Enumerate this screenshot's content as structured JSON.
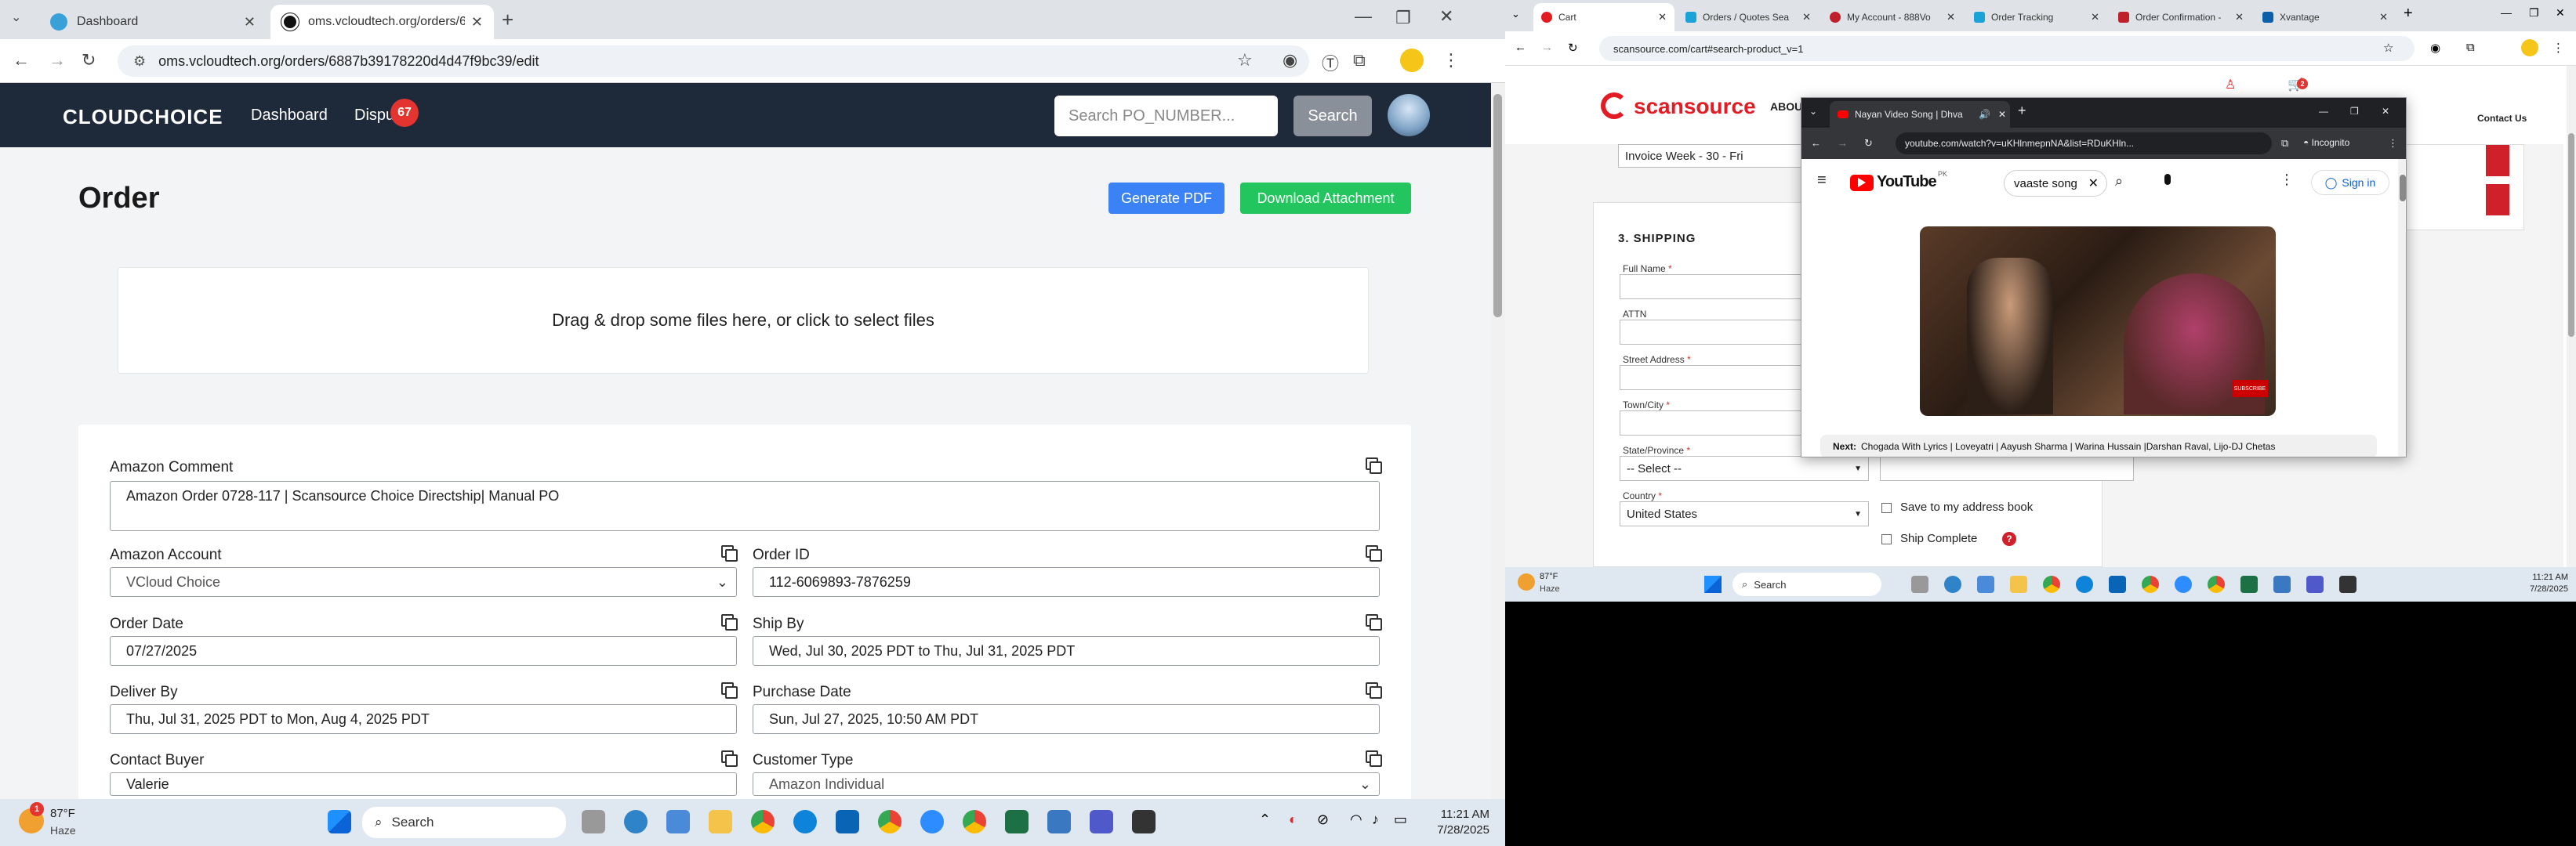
{
  "left_browser": {
    "tabs": [
      {
        "label": "Dashboard"
      },
      {
        "label": "oms.vcloudtech.org/orders/68"
      }
    ],
    "url": "oms.vcloudtech.org/orders/6887b39178220d4d47f9bc39/edit"
  },
  "app": {
    "logo": "CLOUDCHOICE",
    "nav_dashboard": "Dashboard",
    "nav_dispu": "Dispu",
    "dispute_count": "67",
    "search_placeholder": "Search PO_NUMBER...",
    "search_button": "Search"
  },
  "order": {
    "title": "Order",
    "generate_pdf": "Generate PDF",
    "download_attachment": "Download Attachment",
    "dropzone": "Drag & drop some files here, or click to select files",
    "amazon_comment_label": "Amazon Comment",
    "amazon_comment_value": "Amazon Order 0728-117 | Scansource Choice Directship| Manual PO",
    "amazon_account_label": "Amazon Account",
    "amazon_account_value": "VCloud Choice",
    "order_id_label": "Order ID",
    "order_id_value": "112-6069893-7876259",
    "order_date_label": "Order Date",
    "order_date_value": "07/27/2025",
    "ship_by_label": "Ship By",
    "ship_by_value": "Wed, Jul 30, 2025 PDT to Thu, Jul 31, 2025 PDT",
    "deliver_by_label": "Deliver By",
    "deliver_by_value": "Thu, Jul 31, 2025 PDT to Mon, Aug 4, 2025 PDT",
    "purchase_date_label": "Purchase Date",
    "purchase_date_value": "Sun, Jul 27, 2025, 10:50 AM PDT",
    "contact_buyer_label": "Contact Buyer",
    "contact_buyer_value": "Valerie",
    "customer_type_label": "Customer Type",
    "customer_type_value": "Amazon Individual"
  },
  "left_taskbar": {
    "weather_temp": "87°F",
    "weather_desc": "Haze",
    "weather_badge": "1",
    "search": "Search",
    "time": "11:21 AM",
    "date": "7/28/2025"
  },
  "right_browser": {
    "tabs": [
      {
        "label": "Cart"
      },
      {
        "label": "Orders / Quotes Sea"
      },
      {
        "label": "My Account - 888Vo"
      },
      {
        "label": "Order Tracking"
      },
      {
        "label": "Order Confirmation -"
      },
      {
        "label": "Xvantage"
      }
    ],
    "url": "scansource.com/cart#search-product_v=1"
  },
  "scansource": {
    "logo": "scansource",
    "nav_about": "ABOU",
    "contact_us": "Contact Us",
    "cart_count": "2",
    "invoice_value": "Invoice Week - 30 - Fri",
    "shipping_heading": "3. SHIPPING",
    "full_name_label": "Full Name",
    "attn_label": "ATTN",
    "street_label": "Street Address",
    "town_label": "Town/City",
    "state_label": "State/Province",
    "state_value": "-- Select --",
    "country_label": "Country",
    "country_value": "United States",
    "save_address": "Save to my address book",
    "ship_complete": "Ship Complete",
    "help": "?",
    "req": "*"
  },
  "youtube": {
    "tab_title": "Nayan Video Song | Dhva",
    "url": "youtube.com/watch?v=uKHlnmepnNA&list=RDuKHln...",
    "incognito": "Incognito",
    "logo": "YouTube",
    "logo_region": "PK",
    "search_value": "vaaste song",
    "signin": "Sign in",
    "subscribe": "SUBSCRIBE",
    "next_label": "Next:",
    "next_value": "Chogada With Lyrics | Loveyatri | Aayush Sharma | Warina Hussain |Darshan Raval, Lijo-DJ Chetas"
  },
  "right_taskbar": {
    "weather_temp": "87°F",
    "weather_desc": "Haze",
    "search": "Search",
    "time": "11:21 AM",
    "date": "7/28/2025"
  }
}
